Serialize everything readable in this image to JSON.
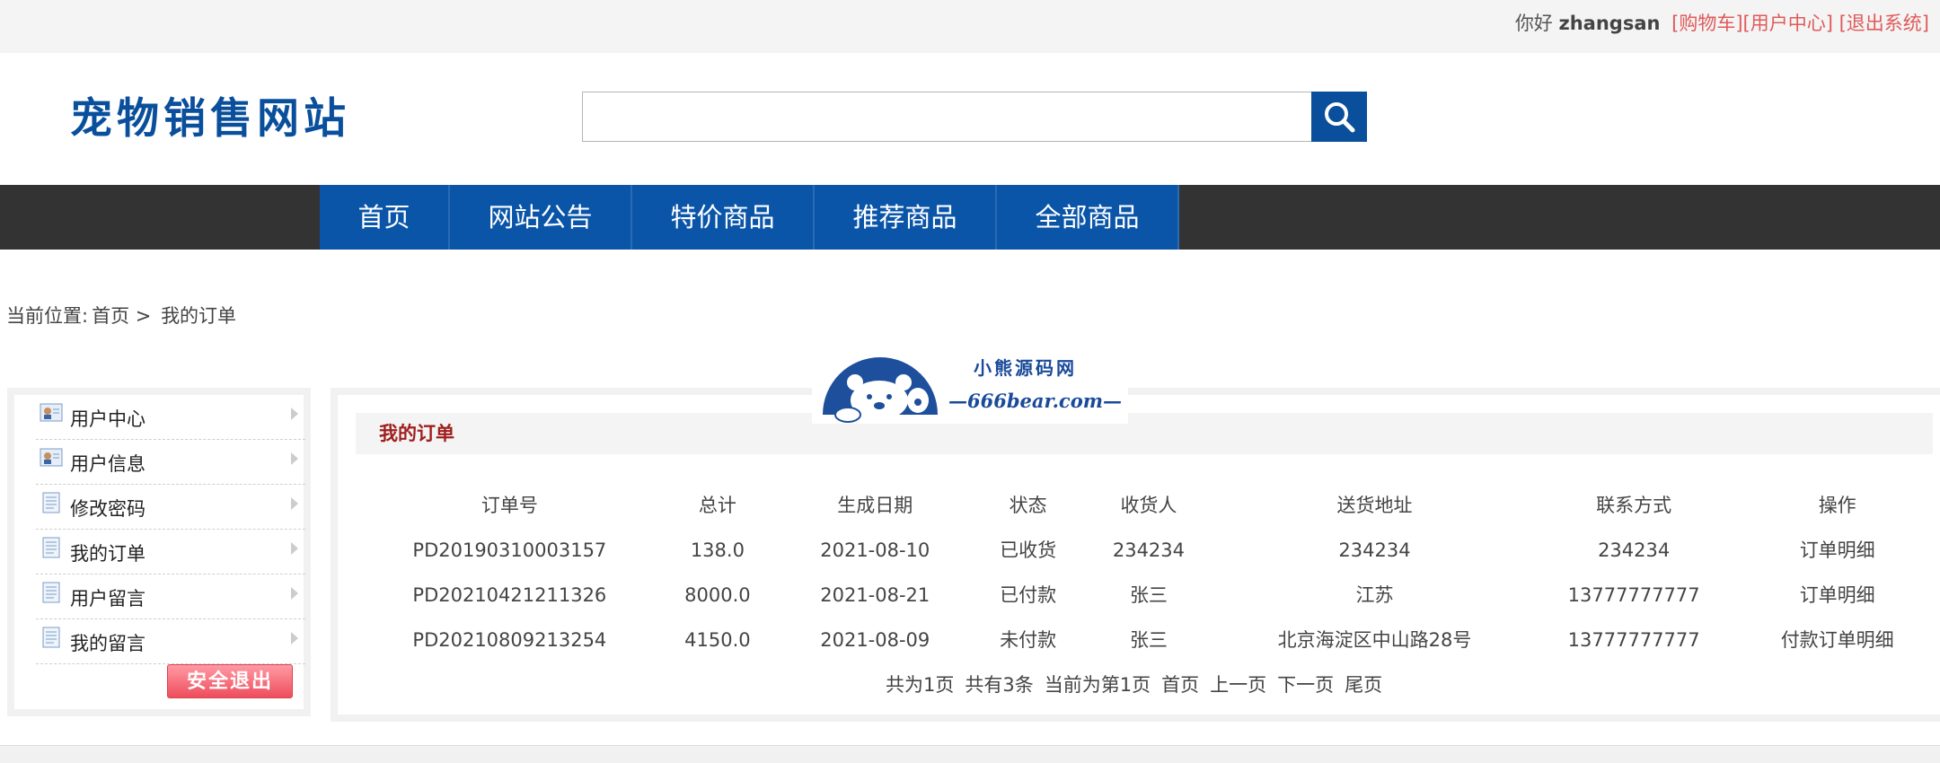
{
  "topbar": {
    "hello": "你好",
    "username": "zhangsan",
    "links": [
      "[购物车]",
      "[用户中心]",
      "[退出系统]"
    ]
  },
  "header": {
    "logo": "宠物销售网站",
    "search_value": "",
    "search_icon": "search-icon"
  },
  "nav": {
    "items": [
      "首页",
      "网站公告",
      "特价商品",
      "推荐商品",
      "全部商品"
    ]
  },
  "breadcrumb": {
    "prefix": "当前位置:",
    "home": "首页",
    "sep": ">",
    "current": "我的订单"
  },
  "watermark": {
    "line1": "小熊源码网",
    "line2": "—666bear.com—"
  },
  "sidebar": {
    "items": [
      {
        "label": "用户中心",
        "icon": "user-card-icon"
      },
      {
        "label": "用户信息",
        "icon": "user-card-icon"
      },
      {
        "label": "修改密码",
        "icon": "document-icon"
      },
      {
        "label": "我的订单",
        "icon": "document-icon"
      },
      {
        "label": "用户留言",
        "icon": "document-icon"
      },
      {
        "label": "我的留言",
        "icon": "document-icon"
      }
    ],
    "logout": "安全退出"
  },
  "orders": {
    "title": "我的订单",
    "columns": [
      "订单号",
      "总计",
      "生成日期",
      "状态",
      "收货人",
      "送货地址",
      "联系方式",
      "操作"
    ],
    "rows": [
      {
        "id": "PD20190310003157",
        "total": "138.0",
        "date": "2021-08-10",
        "status": "已收货",
        "receiver": "234234",
        "address": "234234",
        "phone": "234234",
        "actions": [
          "订单明细"
        ]
      },
      {
        "id": "PD20210421211326",
        "total": "8000.0",
        "date": "2021-08-21",
        "status": "已付款",
        "receiver": "张三",
        "address": "江苏",
        "phone": "13777777777",
        "actions": [
          "订单明细"
        ]
      },
      {
        "id": "PD20210809213254",
        "total": "4150.0",
        "date": "2021-08-09",
        "status": "未付款",
        "receiver": "张三",
        "address": "北京海淀区中山路28号",
        "phone": "13777777777",
        "actions": [
          "付款",
          "订单明细"
        ]
      }
    ]
  },
  "pager": {
    "pages": "共为1页",
    "count": "共有3条",
    "current": "当前为第1页",
    "first": "首页",
    "prev": "上一页",
    "next": "下一页",
    "last": "尾页"
  },
  "colors": {
    "brand_blue": "#0a4f9c",
    "nav_blue": "#0a55a8",
    "nav_dark": "#333333",
    "link_red": "#e05a5a",
    "title_red": "#a01e1e"
  }
}
